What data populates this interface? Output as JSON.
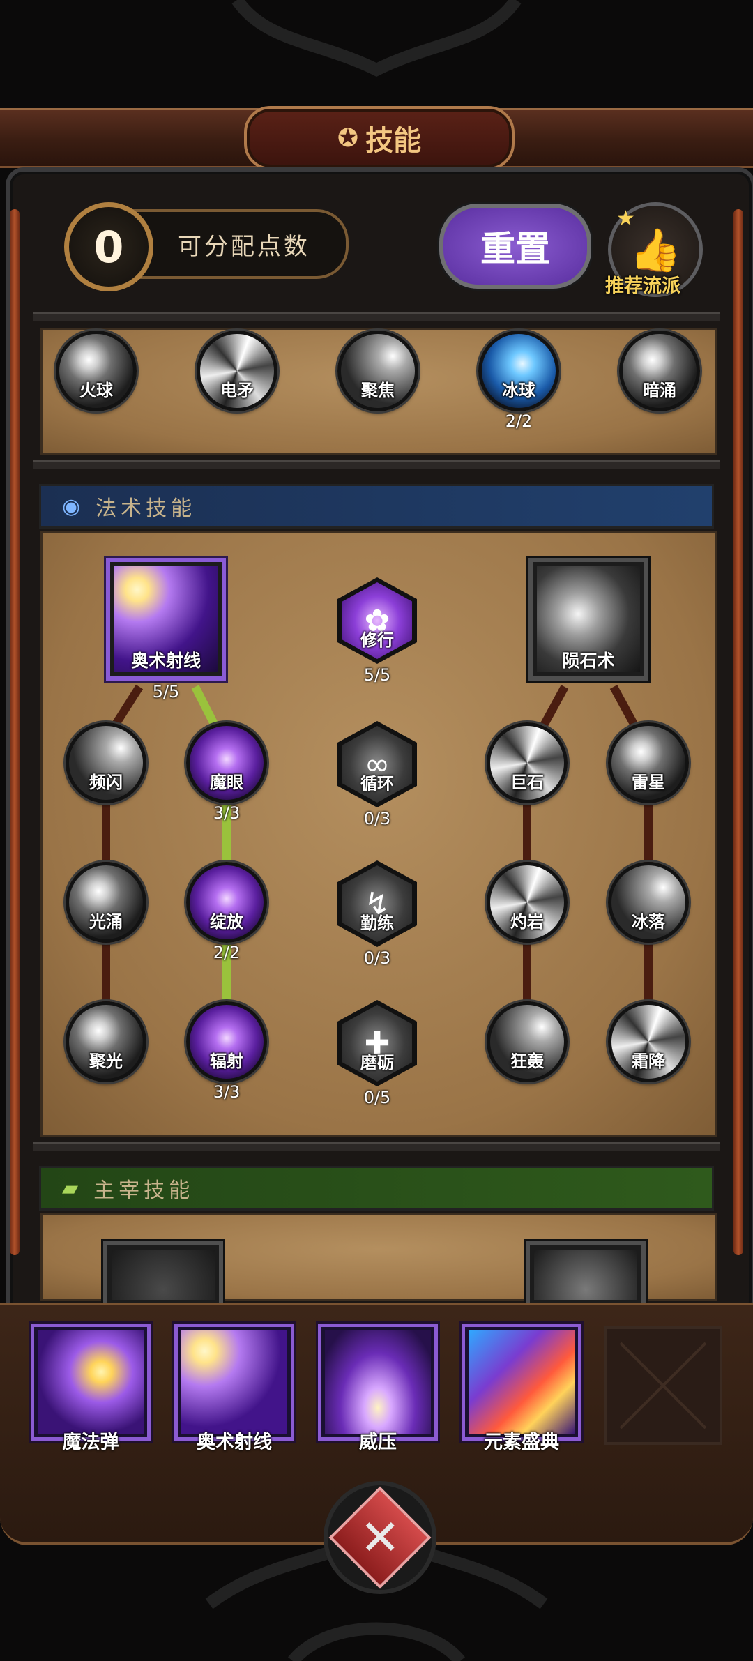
{
  "header": {
    "title": "技能",
    "title_icon": "gear-icon"
  },
  "points": {
    "value": "0",
    "label": "可分配点数"
  },
  "reset_button": {
    "label": "重置"
  },
  "recommend": {
    "label": "推荐流派",
    "icon": "thumbs-up-icon"
  },
  "top_row": [
    {
      "label": "火球",
      "count": ""
    },
    {
      "label": "电矛",
      "count": ""
    },
    {
      "label": "聚焦",
      "count": ""
    },
    {
      "label": "冰球",
      "count": "2/2"
    },
    {
      "label": "暗涌",
      "count": ""
    }
  ],
  "spell_section": {
    "title": "法术技能",
    "arcane_beam": {
      "label": "奥术射线",
      "count": "5/5"
    },
    "cultivation": {
      "label": "修行",
      "count": "5/5"
    },
    "meteor": {
      "label": "陨石术"
    },
    "left_col1": [
      {
        "label": "频闪"
      },
      {
        "label": "光涌"
      },
      {
        "label": "聚光"
      }
    ],
    "left_col2": [
      {
        "label": "魔眼",
        "count": "3/3"
      },
      {
        "label": "绽放",
        "count": "2/2"
      },
      {
        "label": "辐射",
        "count": "3/3"
      }
    ],
    "center_col": [
      {
        "label": "循环",
        "count": "0/3"
      },
      {
        "label": "勤练",
        "count": "0/3"
      },
      {
        "label": "磨砺",
        "count": "0/5"
      }
    ],
    "right_col1": [
      {
        "label": "巨石"
      },
      {
        "label": "灼岩"
      },
      {
        "label": "狂轰"
      }
    ],
    "right_col2": [
      {
        "label": "雷星"
      },
      {
        "label": "冰落"
      },
      {
        "label": "霜降"
      }
    ]
  },
  "master_section": {
    "title": "主宰技能"
  },
  "equipped": [
    {
      "label": "魔法弹"
    },
    {
      "label": "奥术射线"
    },
    {
      "label": "威压"
    },
    {
      "label": "元素盛典"
    }
  ],
  "colors": {
    "accent_purple": "#8b5bd2",
    "link_green": "#9ac23c",
    "section_blue": "#1f3b63",
    "section_green": "#2f5a1c"
  }
}
